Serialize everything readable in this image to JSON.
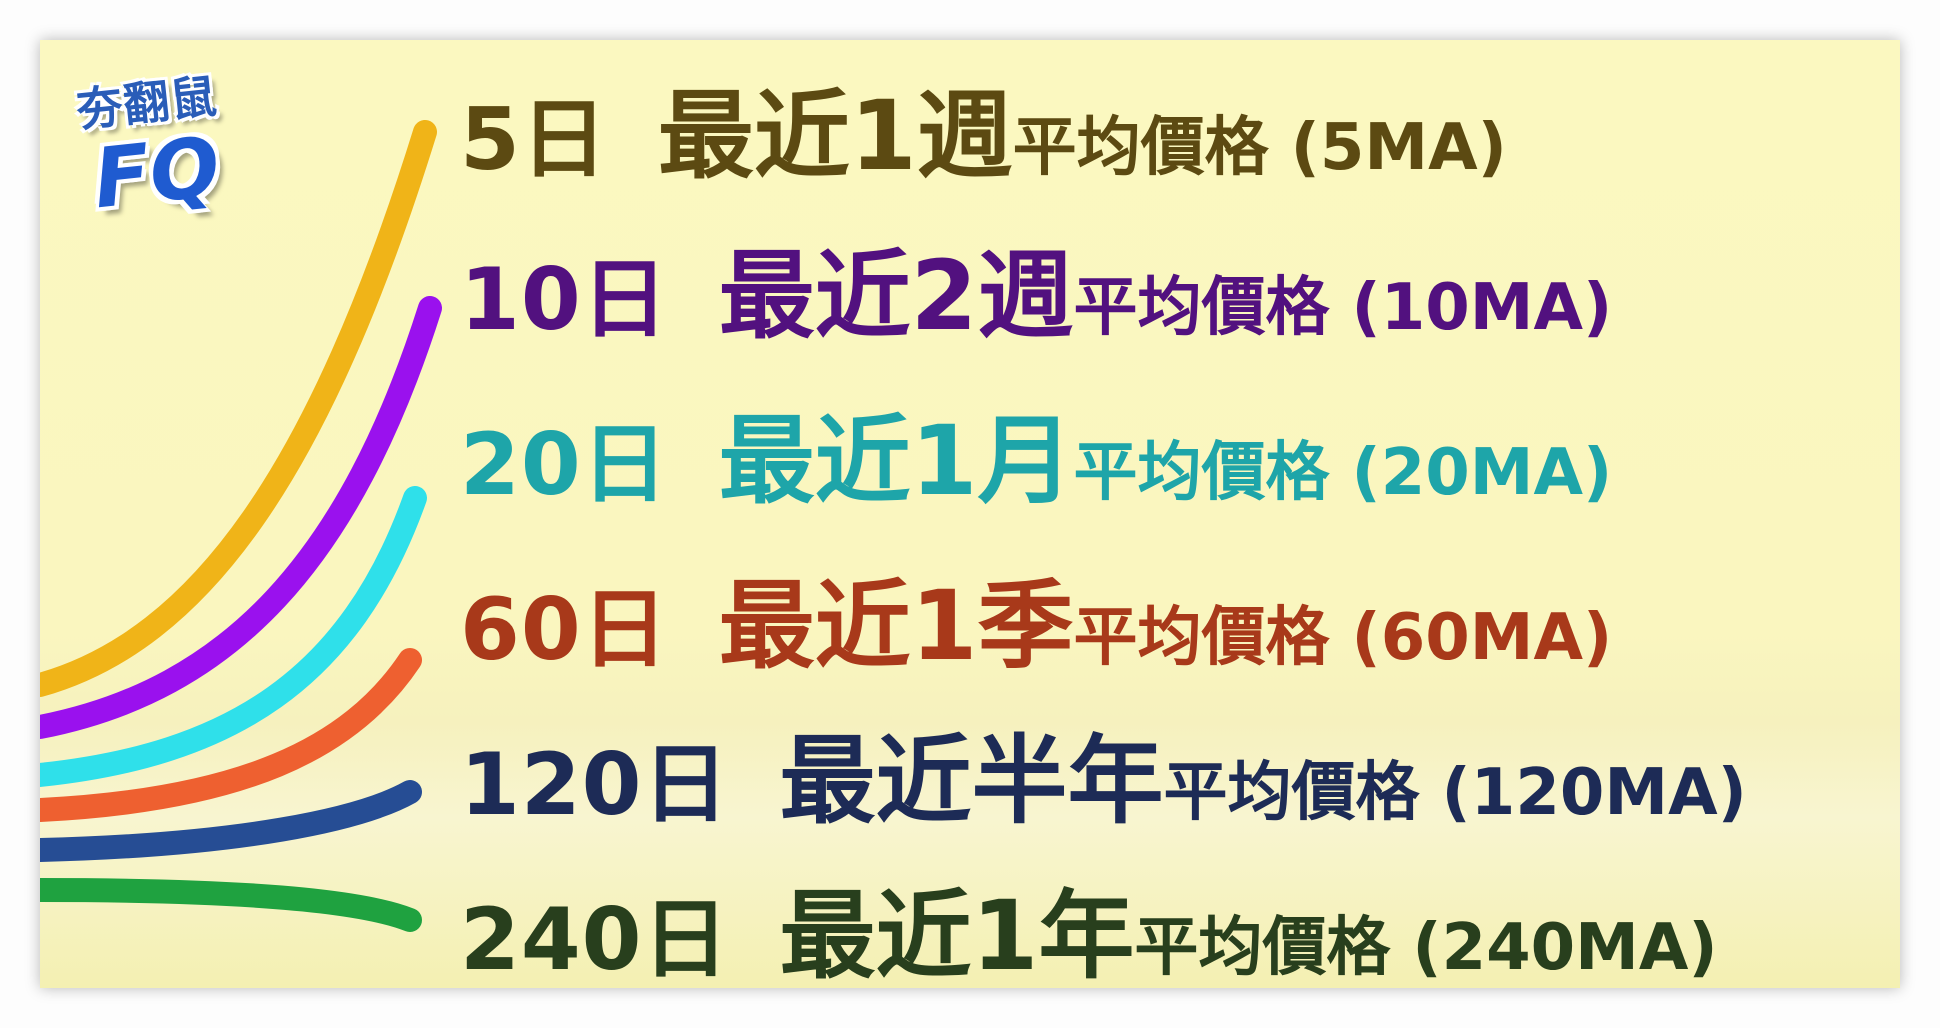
{
  "logo": {
    "brand_cn": "夯翻鼠",
    "brand_en": "FQ"
  },
  "rows": [
    {
      "days": "5日",
      "period": "最近1週",
      "avg": "平均價格",
      "ma": "(5MA)",
      "color": "#5c4a12"
    },
    {
      "days": "10日",
      "period": "最近2週",
      "avg": "平均價格",
      "ma": "(10MA)",
      "color": "#52117f"
    },
    {
      "days": "20日",
      "period": "最近1月",
      "avg": "平均價格",
      "ma": "(20MA)",
      "color": "#1ea5a9"
    },
    {
      "days": "60日",
      "period": "最近1季",
      "avg": "平均價格",
      "ma": "(60MA)",
      "color": "#a8391a"
    },
    {
      "days": "120日",
      "period": "最近半年",
      "avg": "平均價格",
      "ma": "(120MA)",
      "color": "#1d2b56"
    },
    {
      "days": "240日",
      "period": "最近1年",
      "avg": "平均價格",
      "ma": "(240MA)",
      "color": "#283f1d"
    }
  ],
  "curve_colors": [
    "#f0b418",
    "#9a11ee",
    "#2fe0ea",
    "#ee6030",
    "#264d94",
    "#1fa240"
  ]
}
